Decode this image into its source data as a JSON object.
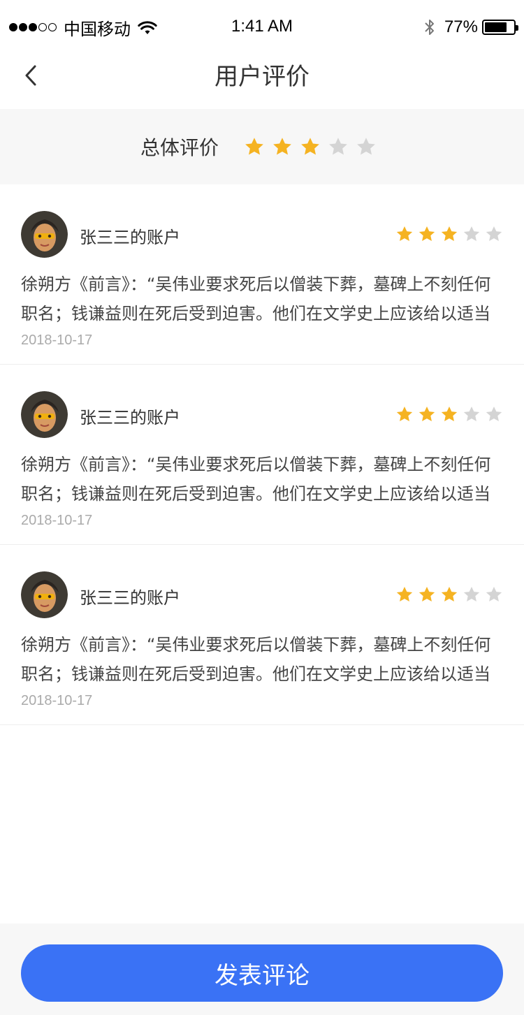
{
  "status_bar": {
    "carrier": "中国移动",
    "time": "1:41 AM",
    "battery_percent": "77%",
    "battery_level": 0.77,
    "signal_bars_filled": 3,
    "signal_bars_total": 5
  },
  "nav": {
    "title": "用户评价",
    "back_icon": "chevron-left-icon"
  },
  "overall": {
    "label": "总体评价",
    "rating": 3,
    "max": 5
  },
  "colors": {
    "star_on": "#f5b322",
    "star_off": "#d4d4d4",
    "accent": "#3a72f5"
  },
  "reviews": [
    {
      "username": "张三三的账户",
      "rating": 3,
      "text": "徐朔方《前言》：“吴伟业要求死后以僧装下葬，墓碑上不刻任何职名；钱谦益则在死后受到迫害。他们在文学史上应该给以适当",
      "date": "2018-10-17"
    },
    {
      "username": "张三三的账户",
      "rating": 3,
      "text": "徐朔方《前言》：“吴伟业要求死后以僧装下葬，墓碑上不刻任何职名；钱谦益则在死后受到迫害。他们在文学史上应该给以适当",
      "date": "2018-10-17"
    },
    {
      "username": "张三三的账户",
      "rating": 3,
      "text": "徐朔方《前言》：“吴伟业要求死后以僧装下葬，墓碑上不刻任何职名；钱谦益则在死后受到迫害。他们在文学史上应该给以适当",
      "date": "2018-10-17"
    }
  ],
  "footer": {
    "post_label": "发表评论"
  }
}
